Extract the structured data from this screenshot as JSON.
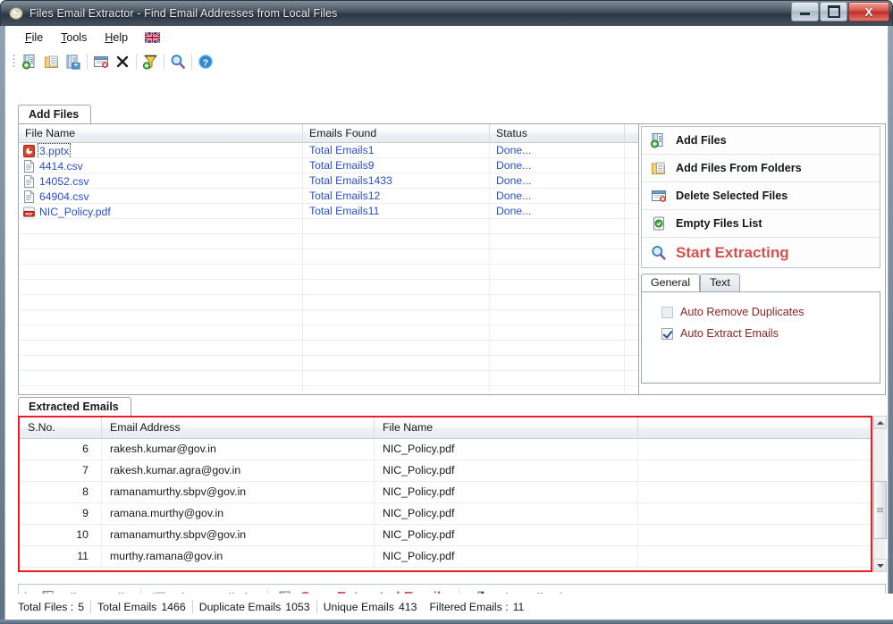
{
  "window": {
    "title": "Files Email Extractor -  Find Email Addresses from Local Files",
    "app_icon": "app-icon",
    "minimize_label": "Minimize",
    "maximize_label": "Maximize",
    "close_label": "Close",
    "close_glyph": "X"
  },
  "menubar": {
    "items": [
      {
        "label": "File",
        "accel": "F"
      },
      {
        "label": "Tools",
        "accel": "T"
      },
      {
        "label": "Help",
        "accel": "H"
      }
    ],
    "flag_icon": "uk-flag-icon"
  },
  "toolbar": {
    "buttons": [
      {
        "name": "add-files-icon",
        "tip": "Add Files"
      },
      {
        "name": "add-folder-icon",
        "tip": "Add Files From Folders"
      },
      {
        "name": "save-file-icon",
        "tip": "Save"
      },
      {
        "name": "delete-selected-icon",
        "tip": "Delete Selected Files"
      },
      {
        "name": "close-x-icon",
        "tip": "Remove"
      },
      {
        "name": "filter-icon",
        "tip": "Filter Emails"
      },
      {
        "name": "search-icon",
        "tip": "Start Extracting"
      },
      {
        "name": "help-icon",
        "tip": "Help"
      }
    ]
  },
  "add_files_panel": {
    "tab_label": "Add Files",
    "columns": [
      "File Name",
      "Emails Found",
      "Status",
      ""
    ],
    "rows": [
      {
        "icon": "pptx-file-icon",
        "file": "3.pptx",
        "emails": "Total Emails1",
        "status": "Done...",
        "extra": ""
      },
      {
        "icon": "csv-file-icon",
        "file": "4414.csv",
        "emails": "Total Emails9",
        "status": "Done...",
        "extra": ""
      },
      {
        "icon": "csv-file-icon",
        "file": "14052.csv",
        "emails": "Total Emails1433",
        "status": "Done...",
        "extra": ""
      },
      {
        "icon": "csv-file-icon",
        "file": "64904.csv",
        "emails": "Total Emails12",
        "status": "Done...",
        "extra": ""
      },
      {
        "icon": "pdf-file-icon",
        "file": "NIC_Policy.pdf",
        "emails": "Total Emails11",
        "status": "Done...",
        "extra": ""
      }
    ],
    "empty_row_count": 12,
    "link_color": "#2b4ed0"
  },
  "actions": {
    "items": [
      {
        "label": "Add Files",
        "icon": "add-files-icon",
        "name": "add-files-button"
      },
      {
        "label": "Add Files From Folders",
        "icon": "add-folder-icon",
        "name": "add-files-from-folders-button"
      },
      {
        "label": "Delete Selected Files",
        "icon": "delete-selected-icon",
        "name": "delete-selected-files-button"
      },
      {
        "label": "Empty Files List",
        "icon": "empty-list-icon",
        "name": "empty-files-list-button"
      }
    ],
    "start_extracting": {
      "label": "Start Extracting",
      "icon": "search-icon",
      "color": "#d6504c"
    }
  },
  "options": {
    "tabs": [
      {
        "label": "General",
        "active": true
      },
      {
        "label": "Text",
        "active": false
      }
    ],
    "checkboxes": [
      {
        "label": "Auto Remove Duplicates",
        "checked": false,
        "name": "auto-remove-duplicates-checkbox"
      },
      {
        "label": "Auto Extract Emails",
        "checked": true,
        "name": "auto-extract-emails-checkbox"
      }
    ],
    "label_color": "#8e2420"
  },
  "extracted_panel": {
    "tab_label": "Extracted Emails",
    "highlight_color": "#ee1c22",
    "columns": [
      "S.No.",
      "Email Address",
      "File Name",
      ""
    ],
    "rows": [
      {
        "sno": "6",
        "email": "rakesh.kumar@gov.in",
        "file": "NIC_Policy.pdf",
        "extra": ""
      },
      {
        "sno": "7",
        "email": "rakesh.kumar.agra@gov.in",
        "file": "NIC_Policy.pdf",
        "extra": ""
      },
      {
        "sno": "8",
        "email": "ramanamurthy.sbpv@gov.in",
        "file": "NIC_Policy.pdf",
        "extra": ""
      },
      {
        "sno": "9",
        "email": "ramana.murthy@gov.in",
        "file": "NIC_Policy.pdf",
        "extra": ""
      },
      {
        "sno": "10",
        "email": "ramanamurthy.sbpv@gov.in",
        "file": "NIC_Policy.pdf",
        "extra": ""
      },
      {
        "sno": "11",
        "email": "murthy.ramana@gov.in",
        "file": "NIC_Policy.pdf",
        "extra": ""
      }
    ],
    "scrollbar": {
      "up_icon": "scroll-up-icon",
      "down_icon": "scroll-down-icon",
      "thumb": "scroll-thumb"
    }
  },
  "bottombar": {
    "buttons": [
      {
        "label": "Filter Emails",
        "icon": "filter-emails-icon",
        "name": "filter-emails-button",
        "accent": false
      },
      {
        "label": "Clear Email List",
        "icon": "clear-list-icon",
        "name": "clear-email-list-button",
        "accent": false
      },
      {
        "label": "Save Extracted Emails",
        "icon": "save-file-icon",
        "name": "save-extracted-emails-button",
        "accent": true
      },
      {
        "label": "Exit Application",
        "icon": "exit-icon",
        "name": "exit-application-button",
        "accent": false
      }
    ]
  },
  "statusbar": {
    "segments": [
      {
        "label": "Total Files :",
        "value": "5"
      },
      {
        "label": "Total Emails",
        "value": "1466"
      },
      {
        "label": "Duplicate Emails",
        "value": "1053"
      },
      {
        "label": "Unique Emails",
        "value": "413"
      },
      {
        "label": "Filtered Emails :",
        "value": "11"
      }
    ]
  }
}
